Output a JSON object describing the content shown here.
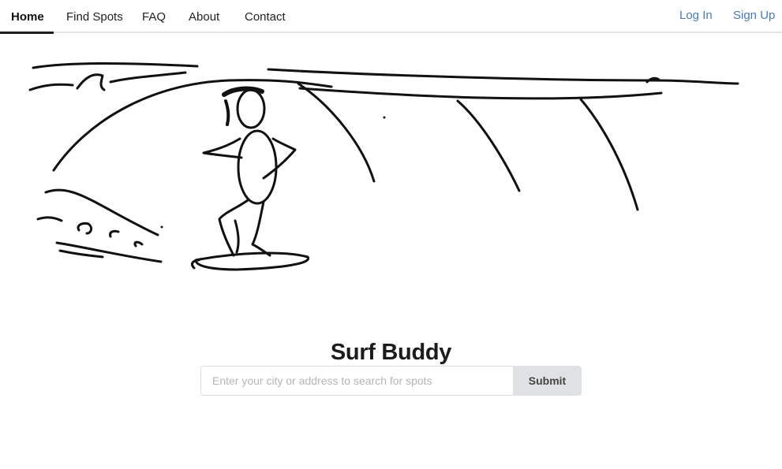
{
  "nav": {
    "items": [
      {
        "label": "Home",
        "active": true
      },
      {
        "label": "Find Spots",
        "active": false
      },
      {
        "label": "FAQ",
        "active": false
      },
      {
        "label": "About",
        "active": false
      },
      {
        "label": "Contact",
        "active": false
      }
    ],
    "login_label": "Log In",
    "signup_label": "Sign Up",
    "link_color": "#4a7bb7"
  },
  "hero": {
    "image_description_icon": "surfer-sketch-icon"
  },
  "main": {
    "title": "Surf Buddy",
    "search": {
      "value": "",
      "placeholder": "Enter your city or address to search for spots"
    },
    "submit_label": "Submit"
  }
}
